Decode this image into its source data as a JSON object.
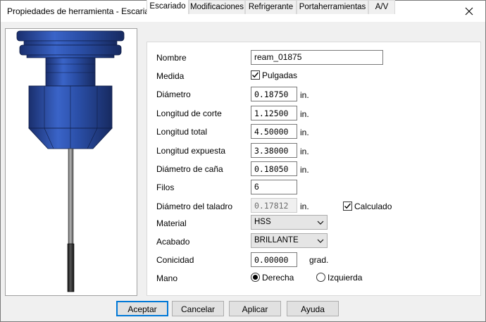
{
  "window": {
    "title": "Propiedades de herramienta - Escariado",
    "close_icon": "close-icon"
  },
  "tabs": [
    {
      "label": "Escariado",
      "active": true
    },
    {
      "label": "Modificaciones",
      "active": false
    },
    {
      "label": "Refrigerante",
      "active": false
    },
    {
      "label": "Portaherramientas",
      "active": false
    },
    {
      "label": "A/V",
      "active": false
    }
  ],
  "form": {
    "nombre": {
      "label": "Nombre",
      "value": "ream_01875"
    },
    "medida": {
      "label": "Medida",
      "checkbox_label": "Pulgadas",
      "checked": true
    },
    "diametro": {
      "label": "Diámetro",
      "value": "0.18750",
      "unit": "in."
    },
    "longitud_corte": {
      "label": "Longitud de corte",
      "value": "1.12500",
      "unit": "in."
    },
    "longitud_total": {
      "label": "Longitud total",
      "value": "4.50000",
      "unit": "in."
    },
    "longitud_expuesta": {
      "label": "Longitud expuesta",
      "value": "3.38000",
      "unit": "in."
    },
    "diametro_cana": {
      "label": "Diámetro de caña",
      "value": "0.18050",
      "unit": "in."
    },
    "filos": {
      "label": "Filos",
      "value": "6"
    },
    "diametro_taladro": {
      "label": "Diámetro del taladro",
      "value": "0.17812",
      "unit": "in.",
      "calc_label": "Calculado",
      "calc_checked": true
    },
    "material": {
      "label": "Material",
      "value": "HSS"
    },
    "acabado": {
      "label": "Acabado",
      "value": "BRILLANTE"
    },
    "conicidad": {
      "label": "Conicidad",
      "value": "0.00000",
      "unit": "grad."
    },
    "mano": {
      "label": "Mano",
      "option_right": "Derecha",
      "option_left": "Izquierda",
      "selected": "Derecha"
    }
  },
  "buttons": {
    "accept": "Aceptar",
    "cancel": "Cancelar",
    "apply": "Aplicar",
    "help": "Ayuda"
  },
  "colors": {
    "tool_body": "#2b4ea8",
    "tool_dark": "#1b2f66",
    "shank": "#8a8a8a",
    "accent": "#0078d7"
  }
}
